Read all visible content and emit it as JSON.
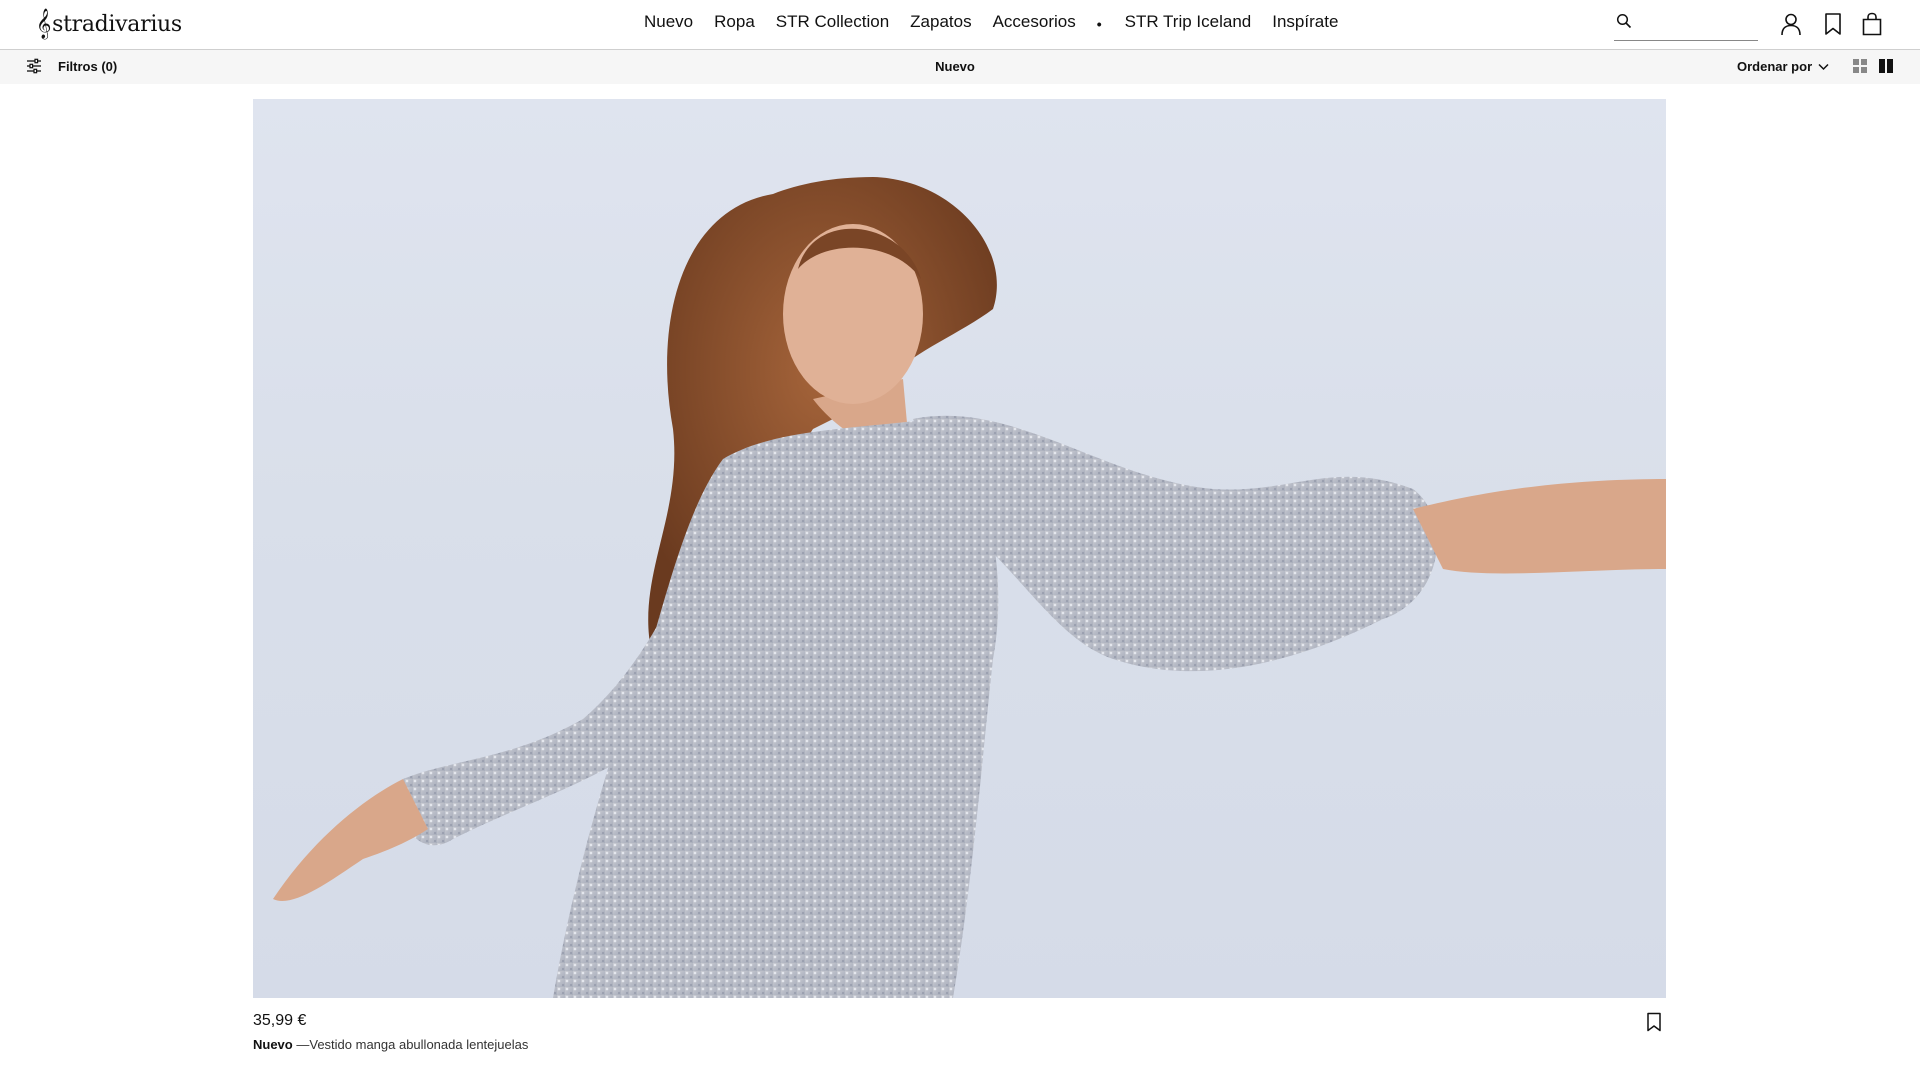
{
  "brand": {
    "name": "stradivarius"
  },
  "nav": {
    "items": [
      "Nuevo",
      "Ropa",
      "STR Collection",
      "Zapatos",
      "Accesorios",
      "•",
      "STR Trip Iceland",
      "Inspírate"
    ]
  },
  "search": {
    "value": "",
    "placeholder": ""
  },
  "header_icons": [
    "search-icon",
    "user-icon",
    "wishlist-icon",
    "bag-icon"
  ],
  "filterbar": {
    "filters_label": "Filtros (0)",
    "title": "Nuevo",
    "sort_label": "Ordenar por",
    "view_options": [
      "grid-view-icon",
      "column-view-icon"
    ],
    "background": "#f6f6f6"
  },
  "product": {
    "price": "35,99 €",
    "tag": "Nuevo",
    "name": "—Vestido manga abullonada lentejuelas"
  },
  "colors": {
    "text": "#111111",
    "divider": "#cfcfcf",
    "photo_bg": "#d9dfea"
  }
}
